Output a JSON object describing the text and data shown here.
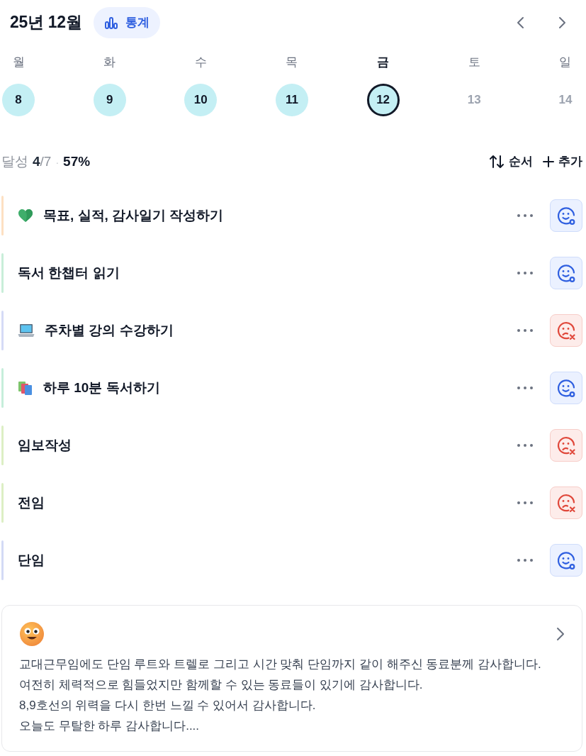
{
  "header": {
    "title": "25년 12월",
    "stats_button": "통계"
  },
  "days": [
    {
      "weekday": "월",
      "date": "8",
      "filled": true,
      "selected": false
    },
    {
      "weekday": "화",
      "date": "9",
      "filled": true,
      "selected": false
    },
    {
      "weekday": "수",
      "date": "10",
      "filled": true,
      "selected": false
    },
    {
      "weekday": "목",
      "date": "11",
      "filled": true,
      "selected": false
    },
    {
      "weekday": "금",
      "date": "12",
      "filled": true,
      "selected": true
    },
    {
      "weekday": "토",
      "date": "13",
      "filled": false,
      "selected": false
    },
    {
      "weekday": "일",
      "date": "14",
      "filled": false,
      "selected": false
    }
  ],
  "summary": {
    "label": "달성",
    "done": "4",
    "total": "/7",
    "separator": "·",
    "percent": "57%"
  },
  "actions": [
    {
      "kind": "sort",
      "label": "순서"
    },
    {
      "kind": "add",
      "label": "추가"
    }
  ],
  "tasks": [
    {
      "title": "목표, 실적, 감사일기 작성하기",
      "kind": "heart",
      "color": "#fde0c2",
      "done": true
    },
    {
      "title": "독서 한챕터 읽기",
      "kind": "plain",
      "color": "#c8eed9",
      "done": true
    },
    {
      "title": "주차별 강의 수강하기",
      "kind": "laptop",
      "color": "#d5dbf6",
      "done": false
    },
    {
      "title": "하루 10분 독서하기",
      "kind": "books",
      "color": "#c6eedb",
      "done": true
    },
    {
      "title": "임보작성",
      "kind": "plain",
      "color": "#dcefc4",
      "done": false
    },
    {
      "title": "전임",
      "kind": "plain",
      "color": "#dcefc4",
      "done": false
    },
    {
      "title": "단임",
      "kind": "plain",
      "color": "#d3daf5",
      "done": true
    }
  ],
  "journal": {
    "lines": [
      "교대근무임에도 단임 루트와 트렐로 그리고 시간 맞춰 단임까지 같이 해주신 동료분께 감사합니다.",
      "여전히 체력적으로 힘들었지만 함께할 수 있는 동료들이 있기에 감사합니다.",
      "8,9호선의 위력을 다시 한번 느낄 수 있어서 감사합니다.",
      "오늘도 무탈한 하루 감사합니다...."
    ]
  }
}
